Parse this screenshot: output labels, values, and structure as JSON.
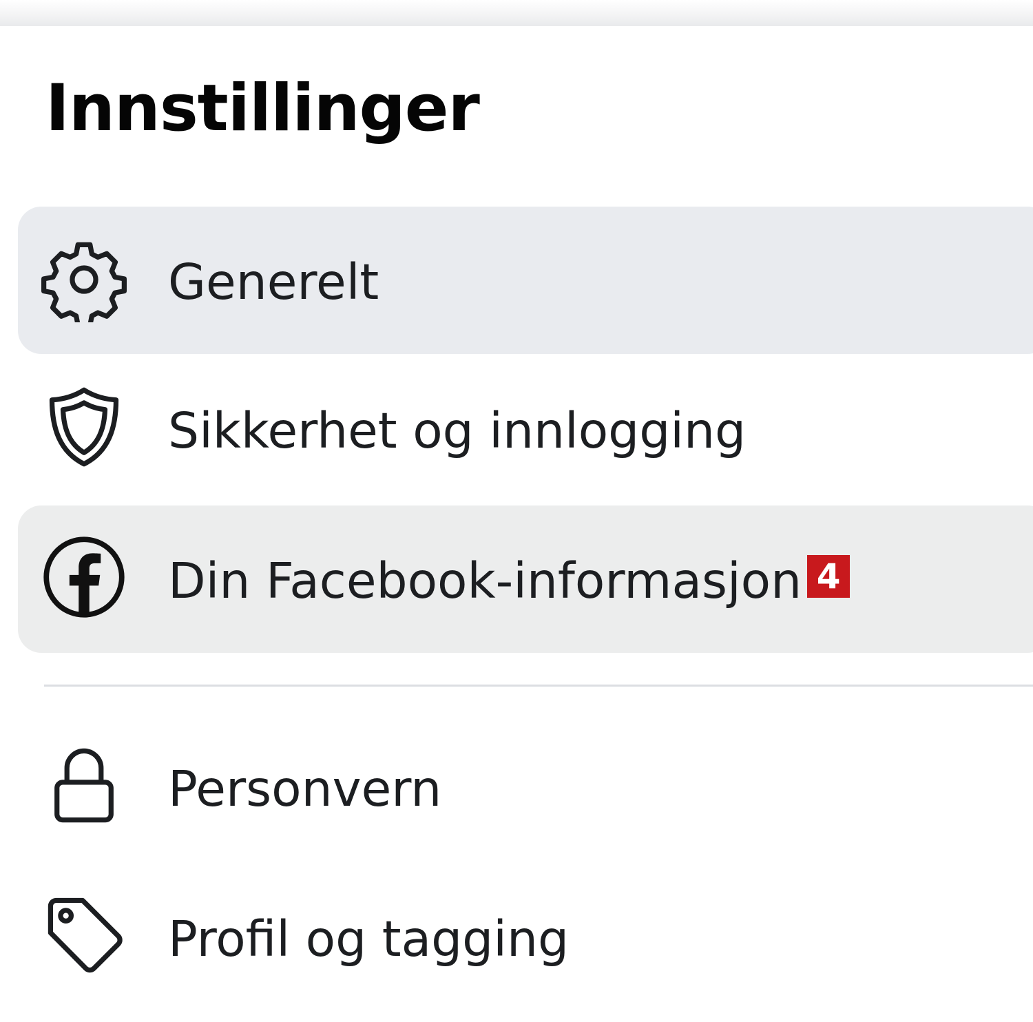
{
  "settings": {
    "title": "Innstillinger",
    "items": [
      {
        "label": "Generelt",
        "icon": "gear-icon",
        "active": true
      },
      {
        "label": "Sikkerhet og innlogging",
        "icon": "shield-icon"
      },
      {
        "label": "Din Facebook-informasjon",
        "icon": "facebook-icon",
        "badge": "4"
      },
      {
        "label": "Personvern",
        "icon": "lock-icon"
      },
      {
        "label": "Profil og tagging",
        "icon": "tag-icon"
      }
    ]
  },
  "colors": {
    "active_background": "#e9ebef",
    "hover_background": "#eceded",
    "badge_background": "#c8191d",
    "text": "#1c1e21"
  }
}
